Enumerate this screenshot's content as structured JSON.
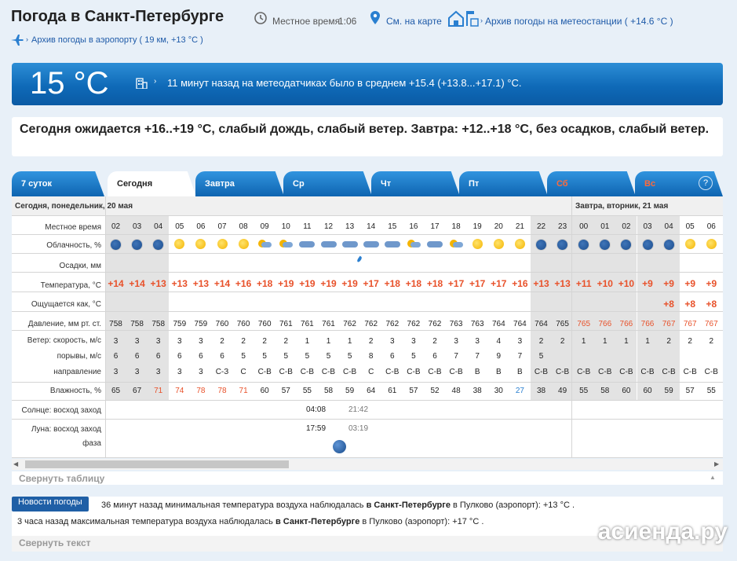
{
  "header": {
    "title": "Погода в Санкт-Петербурге",
    "local_time_label": "Местное время",
    "local_time": "1:06",
    "map_link": "См. на карте",
    "station_archive": "Архив погоды на метеостанции ( +14.6 °C )",
    "airport_archive": "Архив погоды в аэропорту ( 19 км, +13 °C )"
  },
  "now": {
    "temp": "15 °C",
    "text": "11 минут назад на метеодатчиках было в среднем +15.4 (+13.8...+17.1) °C."
  },
  "forecast_text": "Сегодня ожидается +16..+19 °C, слабый дождь, слабый ветер. Завтра: +12..+18 °C, без осадков, слабый ветер.",
  "tabs": [
    "7 суток",
    "Сегодня",
    "Завтра",
    "Ср",
    "Чт",
    "Пт",
    "Сб",
    "Вс"
  ],
  "help_icon": "?",
  "day_headers": [
    "Сегодня, понедельник, 20 мая",
    "Завтра, вторник, 21 мая"
  ],
  "row_labels": {
    "time": "Местное время",
    "clouds": "Облачность, %",
    "precip": "Осадки, мм",
    "temp": "Температура, °C",
    "feels": "Ощущается как, °C",
    "pressure": "Давление, мм рт. ст.",
    "wind_speed": "Ветер: скорость, м/с",
    "gusts": "порывы, м/с",
    "direction": "направление",
    "humidity": "Влажность, %",
    "sun": "Солнце: восход заход",
    "moon": "Луна: восход заход",
    "phase": "фаза"
  },
  "hours": [
    "02",
    "03",
    "04",
    "05",
    "06",
    "07",
    "08",
    "09",
    "10",
    "11",
    "12",
    "13",
    "14",
    "15",
    "16",
    "17",
    "18",
    "19",
    "20",
    "21",
    "22",
    "23",
    "00",
    "01",
    "02",
    "03",
    "04",
    "05",
    "06"
  ],
  "cloud_icons": [
    "moon",
    "moon",
    "moon",
    "sun",
    "sun",
    "sun",
    "sun",
    "pc",
    "pc",
    "cl",
    "cl",
    "cl",
    "cl",
    "cl",
    "pc",
    "cl",
    "pc",
    "sun",
    "sun",
    "sun",
    "moon",
    "moon",
    "moon",
    "moon",
    "moon",
    "moon",
    "moon",
    "sun",
    "sun"
  ],
  "temps": [
    "+14",
    "+14",
    "+13",
    "+13",
    "+13",
    "+14",
    "+16",
    "+18",
    "+19",
    "+19",
    "+19",
    "+19",
    "+17",
    "+18",
    "+18",
    "+18",
    "+17",
    "+17",
    "+17",
    "+16",
    "+13",
    "+13",
    "+11",
    "+10",
    "+10",
    "+9",
    "+9",
    "+9",
    "+9"
  ],
  "feels": [
    "",
    "",
    "",
    "",
    "",
    "",
    "",
    "",
    "",
    "",
    "",
    "",
    "",
    "",
    "",
    "",
    "",
    "",
    "",
    "",
    "",
    "",
    "",
    "",
    "",
    "",
    "+8",
    "+8",
    "+8"
  ],
  "pressure": [
    "758",
    "758",
    "758",
    "759",
    "759",
    "760",
    "760",
    "760",
    "761",
    "761",
    "761",
    "762",
    "762",
    "762",
    "762",
    "762",
    "763",
    "763",
    "764",
    "764",
    "764",
    "765",
    "765",
    "766",
    "766",
    "766",
    "767",
    "767",
    "767"
  ],
  "wind_speed": [
    "3",
    "3",
    "3",
    "3",
    "3",
    "2",
    "2",
    "2",
    "2",
    "1",
    "1",
    "1",
    "2",
    "3",
    "3",
    "2",
    "3",
    "3",
    "4",
    "3",
    "2",
    "2",
    "1",
    "1",
    "1",
    "1",
    "2",
    "2",
    "2"
  ],
  "gusts": [
    "6",
    "6",
    "6",
    "6",
    "6",
    "6",
    "5",
    "5",
    "5",
    "5",
    "5",
    "5",
    "8",
    "6",
    "5",
    "6",
    "7",
    "7",
    "9",
    "7",
    "5",
    "",
    "",
    "",
    "",
    "",
    "",
    "",
    ""
  ],
  "direction": [
    "3",
    "3",
    "3",
    "3",
    "3",
    "С-З",
    "С",
    "С-В",
    "С-В",
    "С-В",
    "С-В",
    "С-В",
    "С",
    "С-В",
    "С-В",
    "С-В",
    "С-В",
    "В",
    "В",
    "В",
    "С-В",
    "С-В",
    "С-В",
    "С-В",
    "С-В",
    "С-В",
    "С-В",
    "С-В",
    "С-В"
  ],
  "humidity": [
    "65",
    "67",
    "71",
    "74",
    "78",
    "78",
    "71",
    "60",
    "57",
    "55",
    "58",
    "59",
    "64",
    "61",
    "57",
    "52",
    "48",
    "38",
    "30",
    "27",
    "38",
    "49",
    "55",
    "58",
    "60",
    "60",
    "59",
    "57",
    "55"
  ],
  "sun": {
    "rise": "04:08",
    "set": "21:42"
  },
  "moon": {
    "rise": "17:59",
    "set": "03:19"
  },
  "collapse_table": "Свернуть таблицу",
  "news": {
    "badge": "Новости погоды",
    "line1_pre": "36 минут назад минимальная температура воздуха наблюдалась ",
    "line1_bold": "в Санкт-Петербурге",
    "line1_post": " в Пулково (аэропорт): +13 °C .",
    "line2_pre": "3 часа назад максимальная температура воздуха наблюдалась ",
    "line2_bold": "в Санкт-Петербурге",
    "line2_post": " в Пулково (аэропорт): +17 °C ."
  },
  "collapse_text": "Свернуть текст",
  "watermark": "асиенда.ру"
}
